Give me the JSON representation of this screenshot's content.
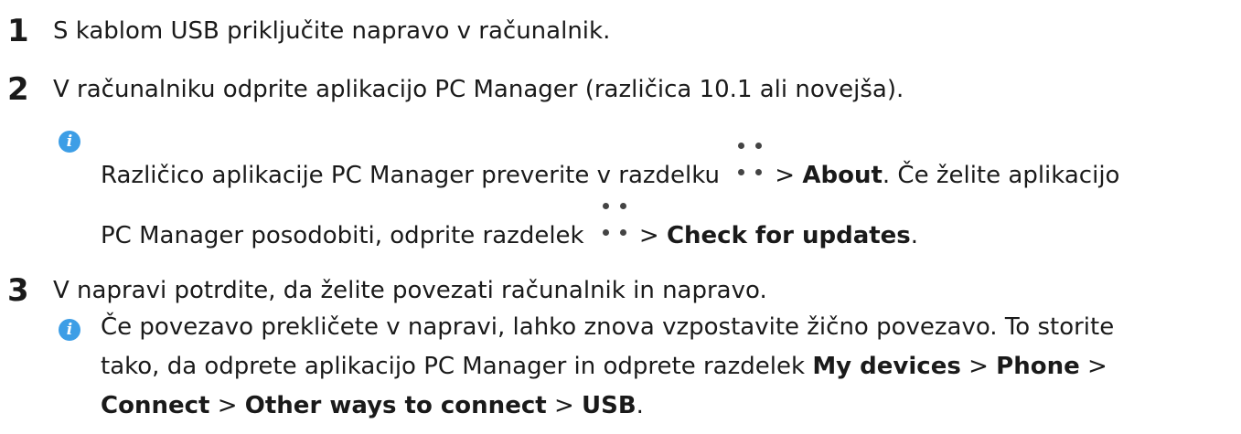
{
  "steps": [
    {
      "number": "1",
      "text": "S kablom USB priključite napravo v računalnik."
    },
    {
      "number": "2",
      "text": "V računalniku odprite aplikacijo PC Manager (različica 10.1 ali novejša)."
    },
    {
      "number": "3",
      "text": "V napravi potrdite, da želite povezati računalnik in napravo."
    }
  ],
  "note1": {
    "icon": "info-icon",
    "line1_prefix": "Različico aplikacije PC Manager preverite v razdelku",
    "sep": ">",
    "about": "About",
    "line1_suffix": ". Če želite aplikacijo",
    "line2_prefix": "PC Manager posodobiti, odprite razdelek",
    "check_updates": "Check for updates",
    "period": "."
  },
  "note2": {
    "icon": "info-icon",
    "line1": "Če povezavo prekličete v napravi, lahko znova vzpostavite žično povezavo. To storite",
    "line2_prefix": "tako, da odprete aplikacijo PC Manager in odprete razdelek",
    "my_devices": "My devices",
    "phone": "Phone",
    "connect": "Connect",
    "other_ways": "Other ways to connect",
    "usb": "USB",
    "sep": ">",
    "period": "."
  },
  "colors": {
    "info_icon": "#3d9ee6",
    "text": "#1a1a1a"
  }
}
